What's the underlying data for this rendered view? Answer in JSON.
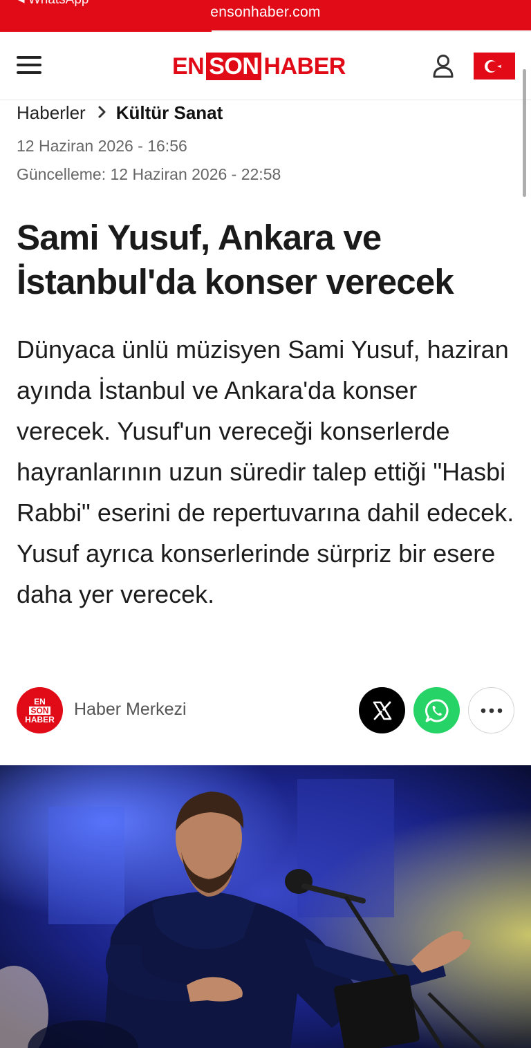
{
  "browser": {
    "back_link": "◂ WhatsApp",
    "domain": "ensonhaber.com"
  },
  "header": {
    "logo": {
      "en": "EN",
      "son": "SON",
      "haber": "HABER"
    },
    "menu_icon": "hamburger-menu-icon",
    "user_icon": "user-account-icon",
    "flag_icon": "turkey-flag-icon"
  },
  "breadcrumb": {
    "home": "Haberler",
    "separator_icon": "chevron-right-icon",
    "current": "Kültür Sanat"
  },
  "dates": {
    "published": "12 Haziran 2026 - 16:56",
    "updated": "Güncelleme: 12 Haziran 2026 - 22:58"
  },
  "article": {
    "headline": "Sami Yusuf, Ankara ve İstanbul'da konser verecek",
    "summary": "Dünyaca ünlü müzisyen Sami Yusuf, haziran ayında İstanbul ve Ankara'da konser verecek. Yusuf'un vereceği konserlerde hayranlarının uzun süredir talep ettiği \"Hasbi Rabbi\" eserini de repertuvarına dahil edecek. Yusuf ayrıca konserlerinde sürpriz bir esere daha yer verecek."
  },
  "author": {
    "avatar": {
      "en": "EN",
      "son": "SON",
      "haber": "HABER"
    },
    "name": "Haber Merkezi"
  },
  "share": {
    "x_icon": "x-twitter-icon",
    "whatsapp_icon": "whatsapp-icon",
    "more_icon": "more-options-icon"
  },
  "colors": {
    "brand_red": "#e10a17",
    "whatsapp_green": "#25d366"
  }
}
